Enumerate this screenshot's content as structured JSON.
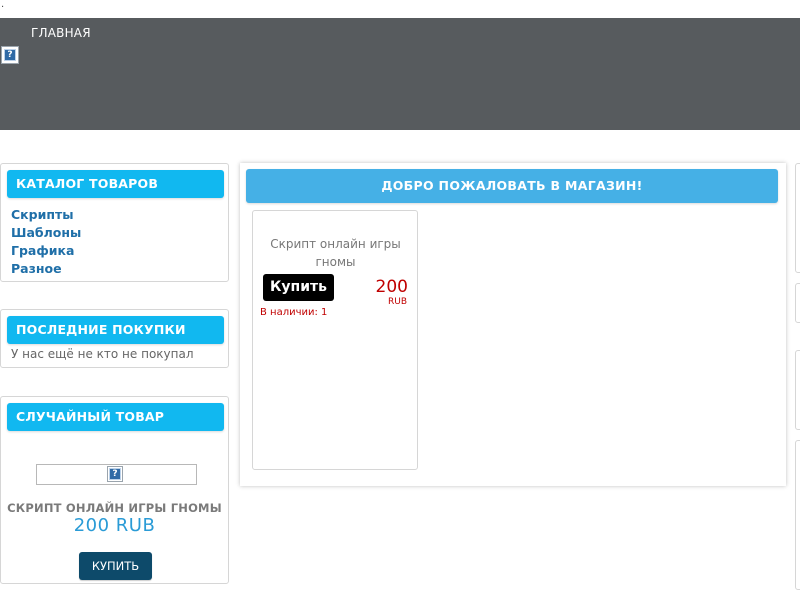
{
  "top_marker": ".",
  "header": {
    "nav_home": "ГЛАВНАЯ",
    "broken_image_glyph": "?"
  },
  "sidebar": {
    "catalog": {
      "title": "КАТАЛОГ ТОВАРОВ",
      "items": [
        {
          "label": "Скрипты"
        },
        {
          "label": "Шаблоны"
        },
        {
          "label": "Графика"
        },
        {
          "label": "Разное"
        }
      ]
    },
    "recent": {
      "title": "ПОСЛЕДНИЕ ПОКУПКИ",
      "empty_text": "У нас ещё не кто не покупал"
    },
    "random": {
      "title": "СЛУЧАЙНЫЙ ТОВАР",
      "broken_image_glyph": "?",
      "product_name": "СКРИПТ ОНЛАЙН ИГРЫ ГНОМЫ",
      "price": "200 RUB",
      "buy_label": "КУПИТЬ"
    }
  },
  "main": {
    "welcome": "ДОБРО ПОЖАЛОВАТЬ В МАГАЗИН!",
    "products": [
      {
        "name": "Скрипт онлайн игры гномы",
        "buy_label": "Купить",
        "price": "200",
        "currency": "RUB",
        "stock": "В наличии: 1"
      }
    ]
  },
  "colors": {
    "header_bg": "#575b5e",
    "sidebar_title_bg": "#11b8f0",
    "welcome_bg": "#45b0e6",
    "link": "#1f6fa8",
    "price_red": "#c00000",
    "random_price_blue": "#2a9bd6",
    "random_buy_bg": "#0d4a6a"
  },
  "icons": [
    "broken-image-icon"
  ]
}
